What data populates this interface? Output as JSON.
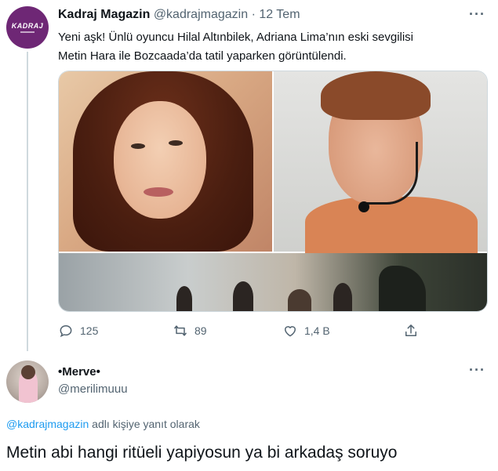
{
  "tweet": {
    "author_name": "Kadraj Magazin",
    "author_handle": "@kadrajmagazin",
    "separator": "·",
    "date": "12 Tem",
    "avatar_logo_text": "KADRAJ",
    "text_line1": "Yeni aşk! Ünlü oyuncu Hilal Altınbilek, Adriana Lima’nın eski sevgilisi",
    "text_line2": "Metin Hara ile Bozcaada’da tatil yaparken görüntülendi.",
    "more_icon": "···",
    "actions": {
      "replies": "125",
      "retweets": "89",
      "likes": "1,4 B"
    }
  },
  "reply": {
    "author_name": "•Merve•",
    "author_handle": "@merilimuuu",
    "more_icon": "···",
    "reply_to_mention": "@kadrajmagazin",
    "reply_to_suffix": " adlı kişiye yanıt olarak",
    "text": "Metin abi hangi ritüeli yapiyosun ya bi arkadaş soruyo"
  },
  "colors": {
    "text_primary": "#0f1419",
    "text_secondary": "#536471",
    "link": "#1d9bf0",
    "kadraj_brand": "#6e2775",
    "border": "#cfd9de"
  },
  "icons": {
    "reply": "speech-bubble-icon",
    "retweet": "retweet-icon",
    "like": "heart-icon",
    "share": "share-icon",
    "more": "more-dots-icon"
  }
}
